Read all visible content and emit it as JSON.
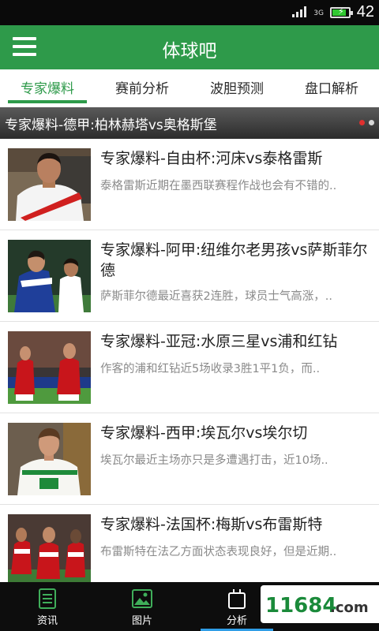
{
  "status_bar": {
    "network": "3G",
    "time": "42",
    "battery_fill": 0.85
  },
  "app_bar": {
    "title": "体球吧",
    "menu_icon": "hamburger-menu-icon"
  },
  "tabs": [
    {
      "label": "专家爆料",
      "active": true
    },
    {
      "label": "赛前分析",
      "active": false
    },
    {
      "label": "波胆预测",
      "active": false
    },
    {
      "label": "盘口解析",
      "active": false
    }
  ],
  "banner": {
    "text": "专家爆料-德甲:柏林赫塔vs奥格斯堡",
    "dots": 2,
    "active_dot": 0
  },
  "news": [
    {
      "title": "专家爆料-自由杯:河床vs泰格雷斯",
      "summary": "泰格雷斯近期在墨西联赛程作战也会有不错的..",
      "image": "river-plate-player-photo"
    },
    {
      "title": "专家爆料-阿甲:纽维尔老男孩vs萨斯菲尔德",
      "summary": "萨斯菲尔德最近喜获2连胜，球员士气高涨，..",
      "image": "football-match-photo"
    },
    {
      "title": "专家爆料-亚冠:水原三星vs浦和红钻",
      "summary": "作客的浦和红钻近5场收录3胜1平1负，而..",
      "image": "urawa-players-photo"
    },
    {
      "title": "专家爆料-西甲:埃瓦尔vs埃尔切",
      "summary": "埃瓦尔最近主场亦只是多遭遇打击，近10场..",
      "image": "elche-player-photo"
    },
    {
      "title": "专家爆料-法国杯:梅斯vs布雷斯特",
      "summary": "布雷斯特在法乙方面状态表现良好，但是近期..",
      "image": "team-celebration-photo"
    }
  ],
  "bottom_nav": [
    {
      "label": "资讯",
      "icon": "news-icon",
      "active": false
    },
    {
      "label": "图片",
      "icon": "picture-icon",
      "active": false
    },
    {
      "label": "分析",
      "icon": "analysis-icon",
      "active": true
    },
    {
      "label": "",
      "icon": "",
      "active": false
    }
  ],
  "watermark": {
    "text": "11684.com",
    "colors": {
      "digits": "#1a8a3a",
      "letters": "#333333"
    }
  },
  "colors": {
    "primary": "#2e9a4a",
    "active_dot": "#e0302f",
    "nav_active": "#2f9de6"
  }
}
